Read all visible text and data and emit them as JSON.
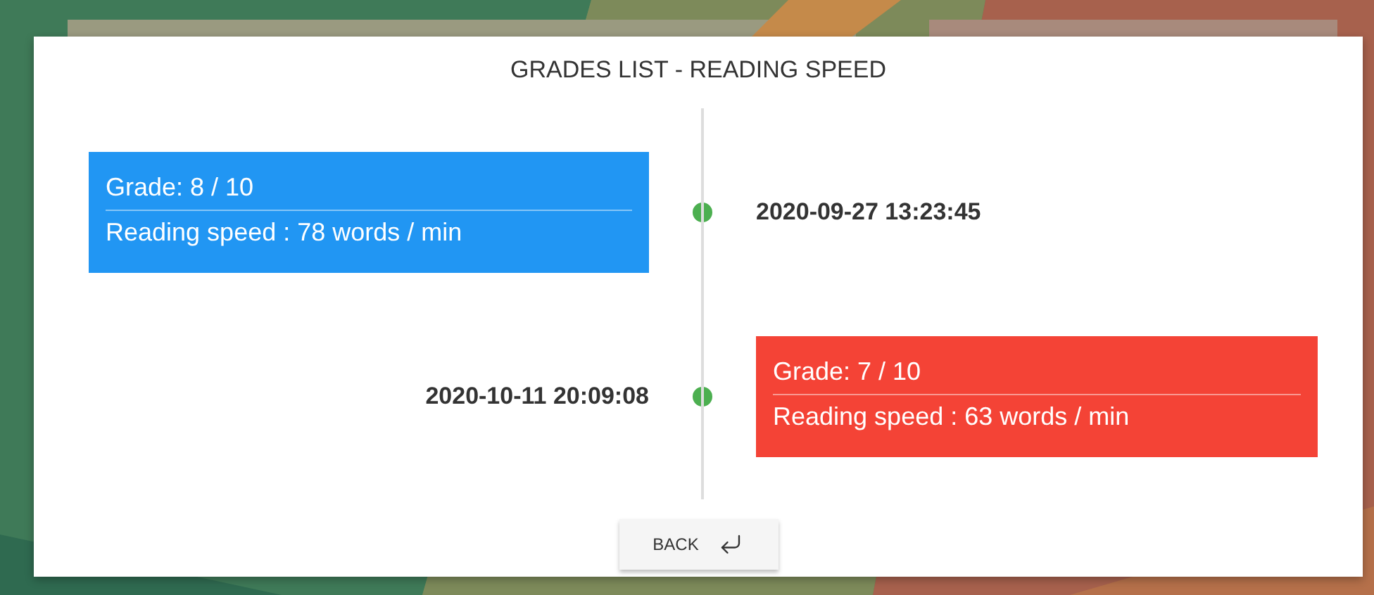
{
  "dialog": {
    "title": "GRADES LIST - READING SPEED"
  },
  "entries": [
    {
      "grade": "Grade: 8 / 10",
      "speed": "Reading speed : 78 words / min",
      "date": "2020-09-27 13:23:45",
      "color": "#2196f3"
    },
    {
      "grade": "Grade: 7 / 10",
      "speed": "Reading speed : 63 words / min",
      "date": "2020-10-11 20:09:08",
      "color": "#f44336"
    }
  ],
  "back_button": {
    "label": "BACK"
  }
}
